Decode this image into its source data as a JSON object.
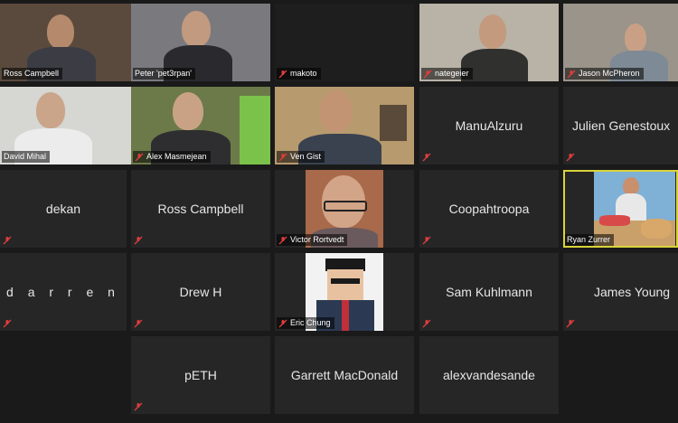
{
  "participants": [
    {
      "name": "Ross Campbell",
      "video": true,
      "muted": false
    },
    {
      "name": "Peter 'pet3rpan'",
      "video": true,
      "muted": false
    },
    {
      "name": "makoto",
      "video": false,
      "muted": true
    },
    {
      "name": "nategeier",
      "video": true,
      "muted": true
    },
    {
      "name": "Jason McPheron",
      "video": true,
      "muted": true
    },
    {
      "name": "David Mihal",
      "video": true,
      "muted": false
    },
    {
      "name": "Alex Masmejean",
      "video": true,
      "muted": true
    },
    {
      "name": "Ven Gist",
      "video": true,
      "muted": true
    },
    {
      "name": "ManuAlzuru",
      "video": false,
      "muted": true
    },
    {
      "name": "Julien Genestoux",
      "video": false,
      "muted": true
    },
    {
      "name": "dekan",
      "video": false,
      "muted": true
    },
    {
      "name": "Ross Campbell",
      "video": false,
      "muted": true
    },
    {
      "name": "Victor Rortvedt",
      "video": true,
      "muted": true
    },
    {
      "name": "Coopahtroopa",
      "video": false,
      "muted": true
    },
    {
      "name": "Ryan Zurrer",
      "video": true,
      "muted": false,
      "active_speaker": true
    },
    {
      "name": "d a r r e n",
      "video": false,
      "muted": true
    },
    {
      "name": "Drew H",
      "video": false,
      "muted": true
    },
    {
      "name": "Eric Chung",
      "video": true,
      "muted": true
    },
    {
      "name": "Sam Kuhlmann",
      "video": false,
      "muted": true
    },
    {
      "name": "James Young",
      "video": false,
      "muted": true
    },
    {
      "name": "pETH",
      "video": false,
      "muted": true
    },
    {
      "name": "Garrett MacDonald",
      "video": false,
      "muted": false
    },
    {
      "name": "alexvandesande",
      "video": false,
      "muted": false
    }
  ],
  "colors": {
    "background": "#1a1a1a",
    "tile": "#262626",
    "active_border": "#d9d33a",
    "muted_icon": "#e03c3c"
  },
  "icons": {
    "muted": "mic-muted-icon"
  }
}
